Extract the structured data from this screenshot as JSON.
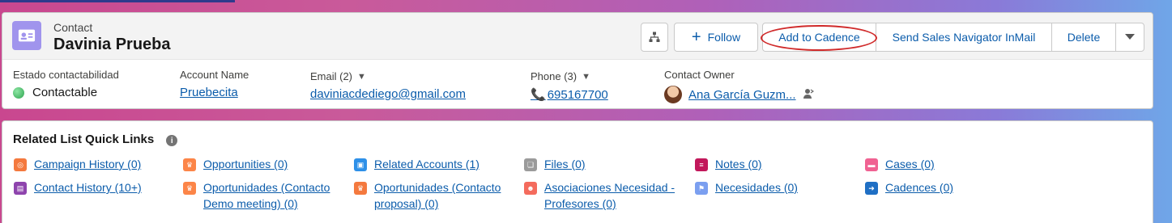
{
  "header": {
    "object_type": "Contact",
    "record_name": "Davinia Prueba",
    "icon": "contact-card-icon",
    "icon_color": "#a094ed"
  },
  "actions": {
    "hierarchy_icon": "hierarchy-icon",
    "follow_label": "Follow",
    "add_to_cadence_label": "Add to Cadence",
    "send_inmail_label": "Send Sales Navigator InMail",
    "delete_label": "Delete",
    "more_icon": "chevron-down-icon"
  },
  "fields": {
    "estado": {
      "label": "Estado contactabilidad",
      "value": "Contactable",
      "status_color": "#2ea44f"
    },
    "account": {
      "label": "Account Name",
      "value": "Pruebecita"
    },
    "email": {
      "label": "Email (2)",
      "value": "daviniacdediego@gmail.com"
    },
    "phone": {
      "label": "Phone (3)",
      "value": "695167700"
    },
    "owner": {
      "label": "Contact Owner",
      "value": "Ana García Guzm..."
    }
  },
  "related": {
    "title": "Related List Quick Links",
    "links": [
      {
        "label": "Campaign History (0)",
        "color": "#f4793e",
        "icon": "campaign-icon"
      },
      {
        "label": "Opportunities (0)",
        "color": "#fc8548",
        "icon": "crown-icon"
      },
      {
        "label": "Related Accounts (1)",
        "color": "#2e90e8",
        "icon": "accounts-icon"
      },
      {
        "label": "Files (0)",
        "color": "#9b9b9b",
        "icon": "file-icon"
      },
      {
        "label": "Notes (0)",
        "color": "#c2185b",
        "icon": "note-icon"
      },
      {
        "label": "Cases (0)",
        "color": "#f06292",
        "icon": "case-icon"
      },
      {
        "label": "Contact History (10+)",
        "color": "#8e44ad",
        "icon": "contact-history-icon"
      },
      {
        "label": "Oportunidades (Contacto Demo meeting) (0)",
        "color": "#fc8548",
        "icon": "crown-icon"
      },
      {
        "label": "Oportunidades (Contacto proposal) (0)",
        "color": "#f4793e",
        "icon": "crown-icon"
      },
      {
        "label": "Asociaciones Necesidad - Profesores (0)",
        "color": "#f46b5d",
        "icon": "people-icon"
      },
      {
        "label": "Necesidades (0)",
        "color": "#7b9ff0",
        "icon": "flag-icon"
      },
      {
        "label": "Cadences (0)",
        "color": "#1f6fc4",
        "icon": "cadence-icon"
      }
    ]
  }
}
